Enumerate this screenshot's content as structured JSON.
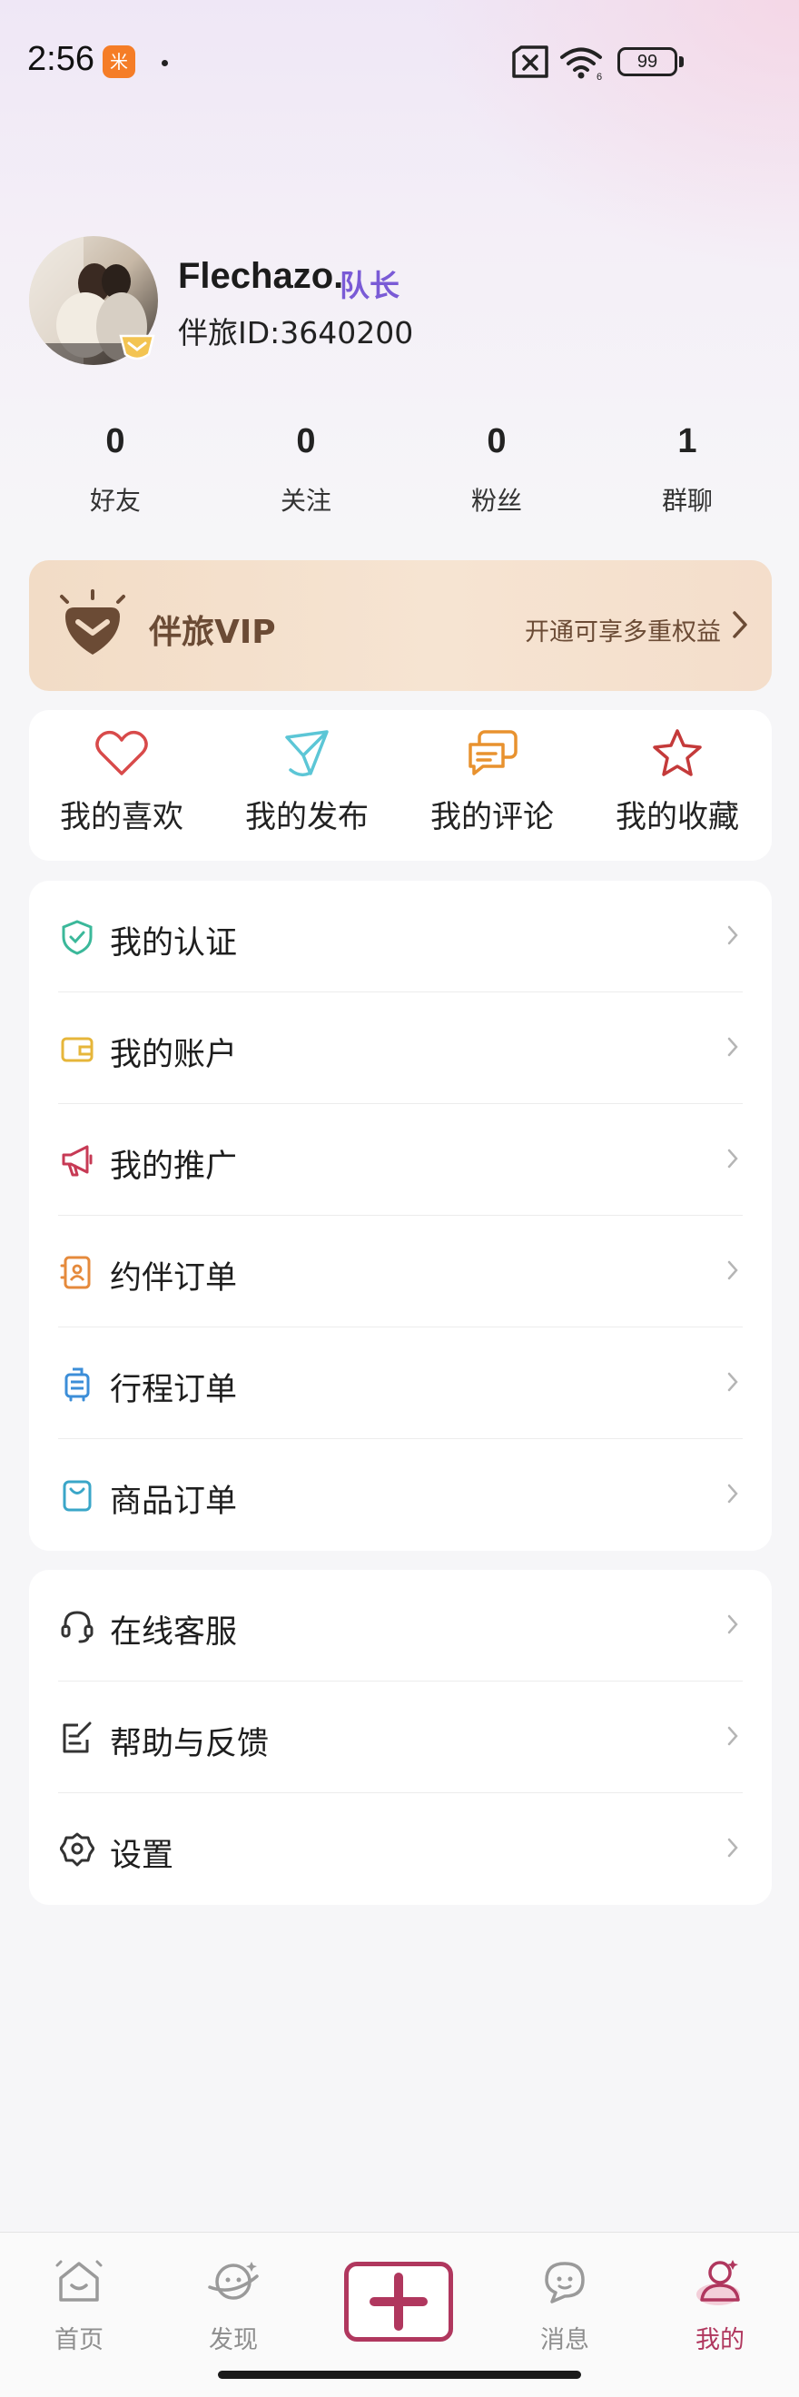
{
  "status_bar": {
    "time": "2:56",
    "app_badge": "米",
    "battery": "99"
  },
  "profile": {
    "username": "Flechazo.",
    "role_tag": "队长",
    "user_id": "伴旅ID:3640200"
  },
  "stats": [
    {
      "value": "0",
      "label": "好友"
    },
    {
      "value": "0",
      "label": "关注"
    },
    {
      "value": "0",
      "label": "粉丝"
    },
    {
      "value": "1",
      "label": "群聊"
    }
  ],
  "vip": {
    "title": "伴旅VIP",
    "hint": "开通可享多重权益"
  },
  "quick_actions": [
    {
      "label": "我的喜欢",
      "icon": "heart-icon",
      "color": "#d84a4a"
    },
    {
      "label": "我的发布",
      "icon": "paper-plane-icon",
      "color": "#5cc6d6"
    },
    {
      "label": "我的评论",
      "icon": "comment-icon",
      "color": "#e8922f"
    },
    {
      "label": "我的收藏",
      "icon": "star-icon",
      "color": "#c43a3a"
    }
  ],
  "menu_primary": [
    {
      "label": "我的认证",
      "icon": "shield-check-icon",
      "color": "#3bb89a"
    },
    {
      "label": "我的账户",
      "icon": "wallet-icon",
      "color": "#e6b63a"
    },
    {
      "label": "我的推广",
      "icon": "megaphone-icon",
      "color": "#c73a55"
    },
    {
      "label": "约伴订单",
      "icon": "companion-order-icon",
      "color": "#e58a3c"
    },
    {
      "label": "行程订单",
      "icon": "luggage-icon",
      "color": "#3c8ed8"
    },
    {
      "label": "商品订单",
      "icon": "shopping-bag-icon",
      "color": "#3aa6c8"
    }
  ],
  "menu_secondary": [
    {
      "label": "在线客服",
      "icon": "headset-icon",
      "color": "#333333"
    },
    {
      "label": "帮助与反馈",
      "icon": "feedback-icon",
      "color": "#333333"
    },
    {
      "label": "设置",
      "icon": "settings-icon",
      "color": "#333333"
    }
  ],
  "bottom_nav": {
    "items": [
      {
        "label": "首页",
        "icon": "home-icon"
      },
      {
        "label": "发现",
        "icon": "discover-icon"
      },
      {
        "label": "消息",
        "icon": "message-icon"
      },
      {
        "label": "我的",
        "icon": "profile-icon",
        "active": true
      }
    ],
    "accent_color": "#b0375e"
  }
}
